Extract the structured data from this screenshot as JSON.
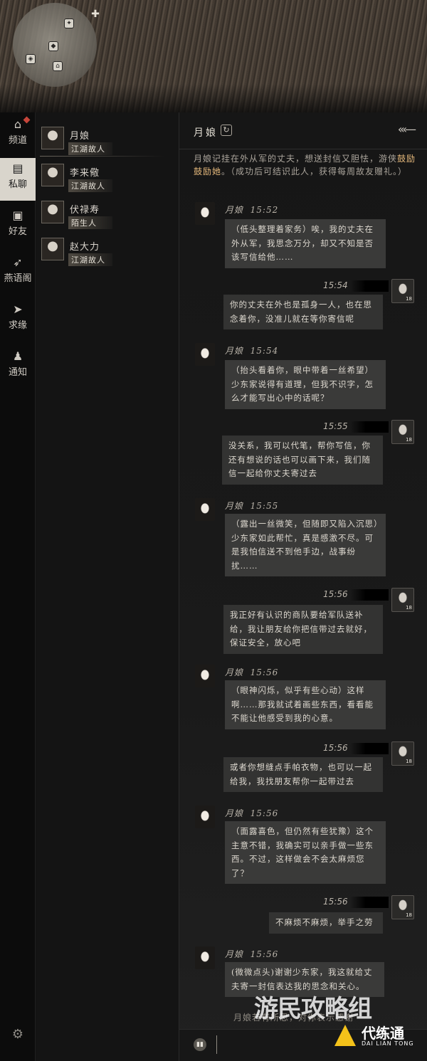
{
  "minimap": {
    "markers": [
      "◆",
      "◈",
      "⌂",
      "✦"
    ]
  },
  "nav": {
    "items": [
      {
        "label": "频道",
        "icon": "home-icon"
      },
      {
        "label": "私聊",
        "icon": "chat-bubble-icon"
      },
      {
        "label": "好友",
        "icon": "friend-book-icon"
      },
      {
        "label": "燕语阁",
        "icon": "swallow-icon"
      },
      {
        "label": "求缘",
        "icon": "paper-plane-icon"
      },
      {
        "label": "通知",
        "icon": "bell-icon"
      }
    ]
  },
  "contacts": [
    {
      "name": "月娘",
      "tag": "江湖故人"
    },
    {
      "name": "李来儆",
      "tag": "江湖故人"
    },
    {
      "name": "伏禄寿",
      "tag": "陌生人"
    },
    {
      "name": "赵大力",
      "tag": "江湖故人"
    }
  ],
  "chat": {
    "title": "月娘",
    "intro_pre": "月娘记挂在外从军的丈夫，想送封信又胆怯，游侠",
    "intro_highlight": "鼓励鼓励她",
    "intro_post": "。（成功后可结识此人，获得每周故友赠礼。）",
    "messages": [
      {
        "sender": "月娘",
        "time": "15:52",
        "text": "（低头整理着家务）唉，我的丈夫在外从军，我思念万分，却又不知是否该写信给他……"
      },
      {
        "time": "15:54",
        "level": "18",
        "text": "你的丈夫在外也是孤身一人，也在思念着你，没准儿就在等你寄信呢"
      },
      {
        "sender": "月娘",
        "time": "15:54",
        "text": "（抬头看着你，眼中带着一丝希望）少东家说得有道理，但我不识字，怎么才能写出心中的话呢？"
      },
      {
        "time": "15:55",
        "level": "18",
        "text": "没关系，我可以代笔，帮你写信，你还有想说的话也可以画下来，我们随信一起给你丈夫寄过去"
      },
      {
        "sender": "月娘",
        "time": "15:55",
        "text": "（露出一丝微笑，但随即又陷入沉思）少东家如此帮忙，真是感激不尽。可是我怕信送不到他手边，战事纷扰……"
      },
      {
        "time": "15:56",
        "level": "18",
        "text": "我正好有认识的商队要给军队送补给，我让朋友给你把信带过去就好，保证安全，放心吧"
      },
      {
        "sender": "月娘",
        "time": "15:56",
        "text": "（眼神闪烁，似乎有些心动）这样啊……那我就试着画些东西，看看能不能让他感受到我的心意。"
      },
      {
        "time": "15:56",
        "level": "18",
        "text": "或者你想缝点手帕衣物，也可以一起给我，我找朋友帮你一起带过去"
      },
      {
        "sender": "月娘",
        "time": "15:56",
        "text": "（面露喜色，但仍然有些犹豫）这个主意不错，我确实可以亲手做一些东西。不过，这样做会不会太麻烦您了？"
      },
      {
        "time": "15:56",
        "level": "18",
        "text": "不麻烦不麻烦，举手之劳"
      },
      {
        "sender": "月娘",
        "time": "15:56",
        "text": "(微微点头)谢谢少东家，我这就给丈夫寄一封信表达我的思念和关心。"
      }
    ],
    "hint": "月娘若有所思，对你表示感谢",
    "input_value": ""
  },
  "watermarks": {
    "main": "游民攻略组",
    "sub_title": "代练通",
    "sub_pinyin": "DAI LIAN TONG"
  }
}
